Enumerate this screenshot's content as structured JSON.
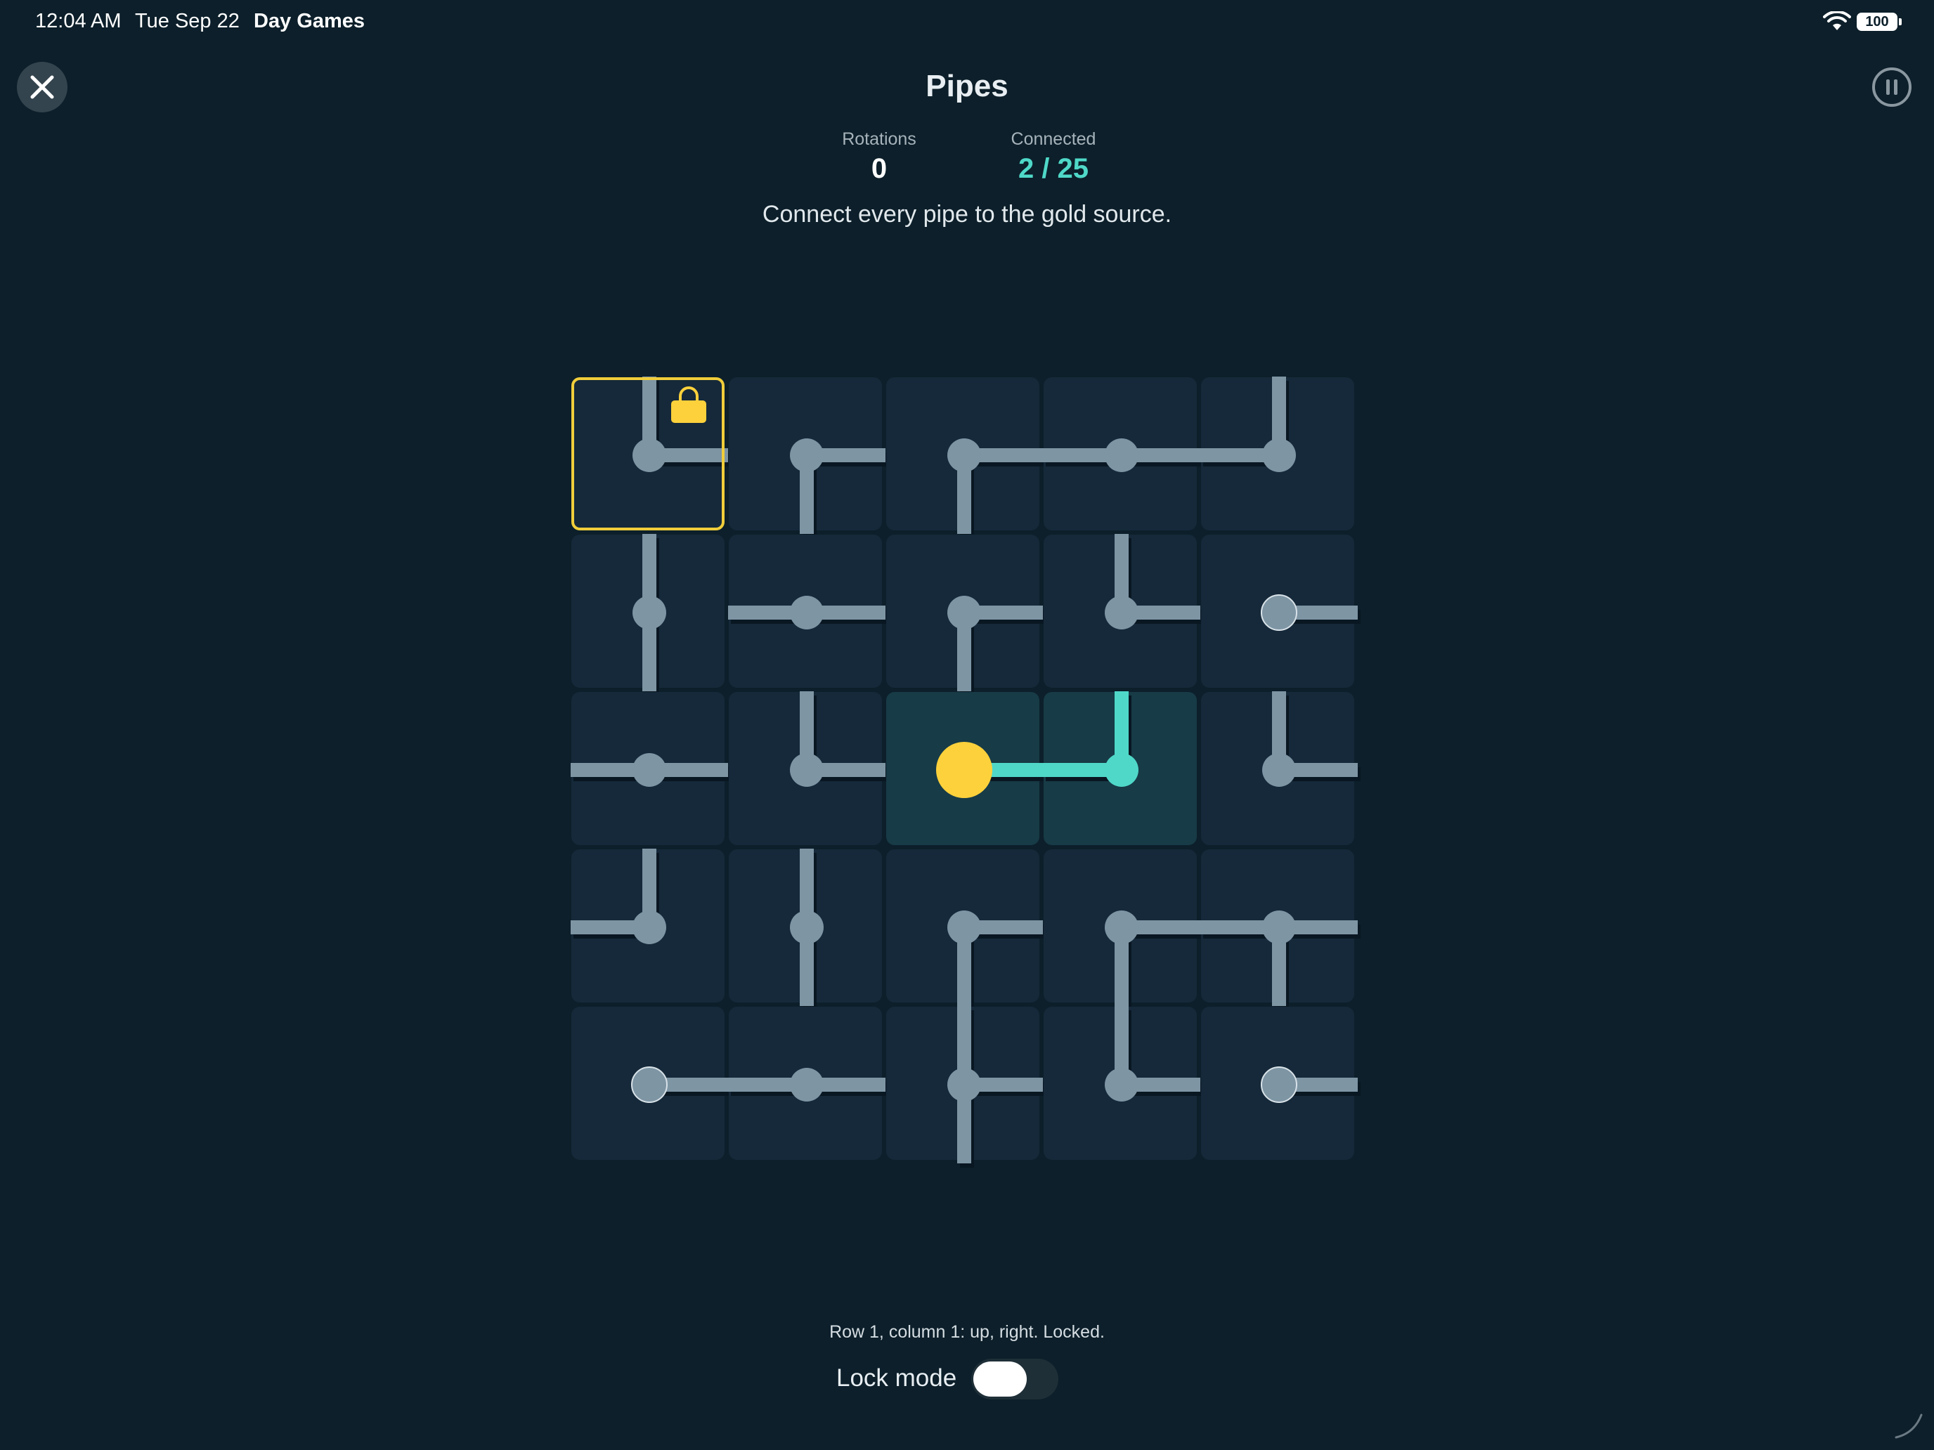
{
  "status_bar": {
    "time": "12:04 AM",
    "date": "Tue Sep 22",
    "app": "Day Games",
    "battery": "100"
  },
  "header": {
    "title": "Pipes",
    "close_icon": "close-icon",
    "pause_icon": "pause-icon"
  },
  "stats": {
    "rotations_label": "Rotations",
    "rotations_value": "0",
    "connected_label": "Connected",
    "connected_value": "2 / 25"
  },
  "instruction": "Connect every pipe to the gold source.",
  "colors": {
    "background": "#0c1f2a",
    "tile": "#15293a",
    "tile_connected": "#173b47",
    "pipe": "#7e95a4",
    "pipe_connected": "#4fd8c8",
    "source": "#fdd13b",
    "focus": "#f0cd3a"
  },
  "board": {
    "rows": 5,
    "cols": 5,
    "focus": {
      "row": 1,
      "col": 1
    },
    "source": {
      "row": 3,
      "col": 3
    },
    "tiles": [
      [
        {
          "u": 1,
          "r": 1,
          "d": 0,
          "l": 0,
          "locked": true,
          "end": false
        },
        {
          "u": 0,
          "r": 1,
          "d": 1,
          "l": 0,
          "end": false
        },
        {
          "u": 0,
          "r": 1,
          "d": 1,
          "l": 0,
          "end": false
        },
        {
          "u": 0,
          "r": 1,
          "d": 0,
          "l": 1,
          "end": false
        },
        {
          "u": 1,
          "r": 0,
          "d": 0,
          "l": 1,
          "end": false
        }
      ],
      [
        {
          "u": 1,
          "r": 0,
          "d": 1,
          "l": 0,
          "end": false
        },
        {
          "u": 0,
          "r": 1,
          "d": 0,
          "l": 1,
          "end": false
        },
        {
          "u": 0,
          "r": 1,
          "d": 1,
          "l": 0,
          "end": false
        },
        {
          "u": 1,
          "r": 1,
          "d": 0,
          "l": 0,
          "end": false
        },
        {
          "u": 0,
          "r": 1,
          "d": 0,
          "l": 0,
          "end": true
        }
      ],
      [
        {
          "u": 0,
          "r": 1,
          "d": 0,
          "l": 1,
          "end": false
        },
        {
          "u": 1,
          "r": 1,
          "d": 0,
          "l": 0,
          "end": false
        },
        {
          "u": 0,
          "r": 1,
          "d": 0,
          "l": 0,
          "end": false,
          "connected": true,
          "source": true
        },
        {
          "u": 1,
          "r": 0,
          "d": 0,
          "l": 1,
          "end": false,
          "connected": true
        },
        {
          "u": 1,
          "r": 1,
          "d": 0,
          "l": 0,
          "end": false
        }
      ],
      [
        {
          "u": 1,
          "r": 0,
          "d": 0,
          "l": 1,
          "end": false
        },
        {
          "u": 1,
          "r": 0,
          "d": 1,
          "l": 0,
          "end": false
        },
        {
          "u": 0,
          "r": 1,
          "d": 1,
          "l": 0,
          "end": false
        },
        {
          "u": 0,
          "r": 1,
          "d": 1,
          "l": 0,
          "end": false
        },
        {
          "u": 0,
          "r": 1,
          "d": 1,
          "l": 1,
          "end": false
        }
      ],
      [
        {
          "u": 0,
          "r": 1,
          "d": 0,
          "l": 0,
          "end": true
        },
        {
          "u": 0,
          "r": 1,
          "d": 0,
          "l": 1,
          "end": false
        },
        {
          "u": 1,
          "r": 1,
          "d": 1,
          "l": 0,
          "end": false
        },
        {
          "u": 1,
          "r": 1,
          "d": 0,
          "l": 0,
          "end": false
        },
        {
          "u": 0,
          "r": 1,
          "d": 0,
          "l": 0,
          "end": true
        }
      ]
    ]
  },
  "footer": {
    "hint": "Row 1, column 1: up, right. Locked.",
    "lock_mode_label": "Lock mode",
    "lock_mode_on": false
  }
}
